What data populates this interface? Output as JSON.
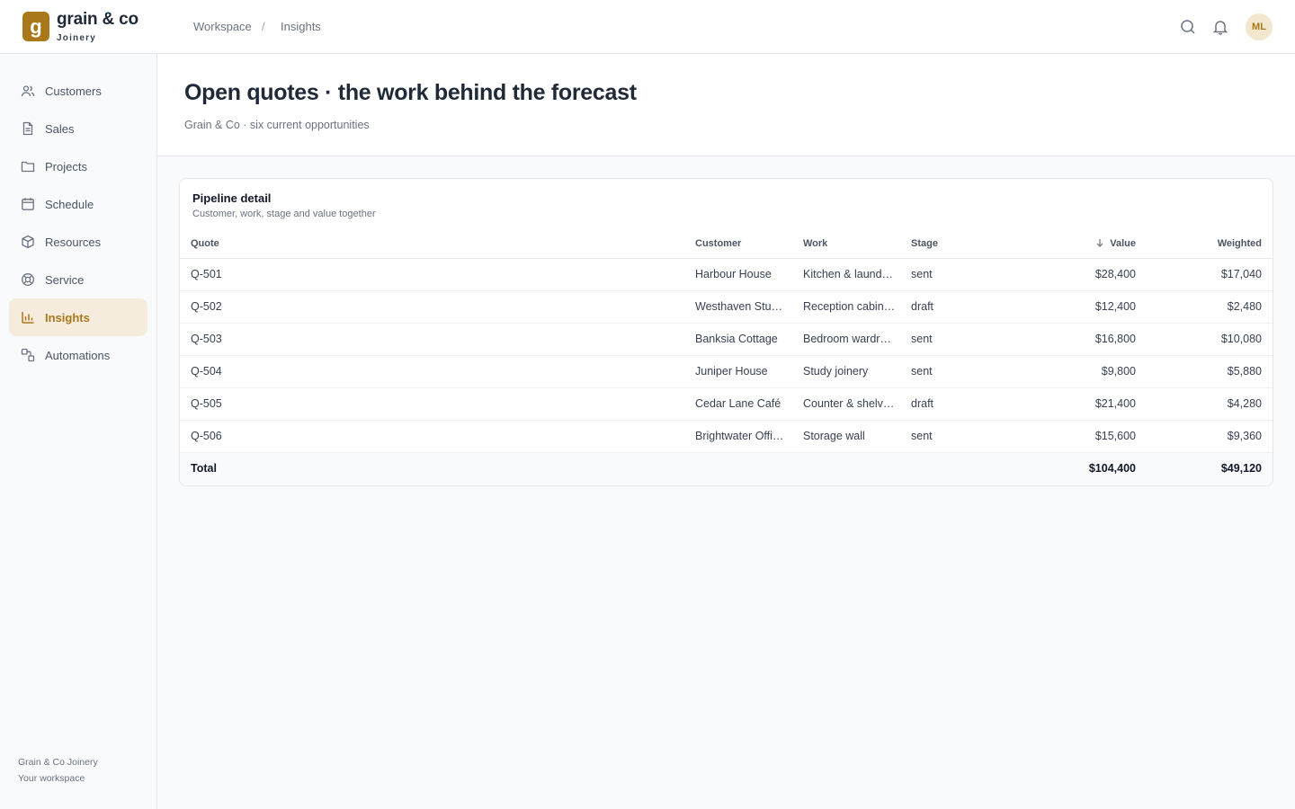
{
  "brand": {
    "logo_letter": "g",
    "name": "grain & co",
    "sub": "Joinery"
  },
  "breadcrumb": {
    "items": [
      "Workspace",
      "Insights"
    ],
    "separator": "/"
  },
  "header_icons": [
    "search-icon",
    "bell-icon"
  ],
  "user": {
    "initials": "ML"
  },
  "sidebar": {
    "items": [
      {
        "label": "Customers",
        "icon": "users-icon"
      },
      {
        "label": "Sales",
        "icon": "document-icon"
      },
      {
        "label": "Projects",
        "icon": "folder-icon"
      },
      {
        "label": "Schedule",
        "icon": "calendar-icon"
      },
      {
        "label": "Resources",
        "icon": "box-icon"
      },
      {
        "label": "Service",
        "icon": "lifebuoy-icon"
      },
      {
        "label": "Insights",
        "icon": "bar-chart-icon",
        "active": true
      },
      {
        "label": "Automations",
        "icon": "automation-icon"
      }
    ],
    "footer_line1": "Grain & Co Joinery",
    "footer_line2": "Your workspace"
  },
  "page": {
    "title": "Open quotes · the work behind the forecast",
    "subtitle": "Grain & Co · six current opportunities"
  },
  "card": {
    "title": "Pipeline detail",
    "subtitle": "Customer, work, stage and value together",
    "columns": {
      "quote": "Quote",
      "customer": "Customer",
      "work": "Work",
      "stage": "Stage",
      "value": "Value",
      "weighted": "Weighted"
    },
    "sort": {
      "column": "value",
      "direction": "descending"
    },
    "rows": [
      {
        "quote": "Q-501",
        "customer": "Harbour House",
        "work": "Kitchen & laund…",
        "stage": "sent",
        "value": "$28,400",
        "weighted": "$17,040"
      },
      {
        "quote": "Q-502",
        "customer": "Westhaven Stu…",
        "work": "Reception cabin…",
        "stage": "draft",
        "value": "$12,400",
        "weighted": "$2,480"
      },
      {
        "quote": "Q-503",
        "customer": "Banksia Cottage",
        "work": "Bedroom wardr…",
        "stage": "sent",
        "value": "$16,800",
        "weighted": "$10,080"
      },
      {
        "quote": "Q-504",
        "customer": "Juniper House",
        "work": "Study joinery",
        "stage": "sent",
        "value": "$9,800",
        "weighted": "$5,880"
      },
      {
        "quote": "Q-505",
        "customer": "Cedar Lane Café",
        "work": "Counter & shelv…",
        "stage": "draft",
        "value": "$21,400",
        "weighted": "$4,280"
      },
      {
        "quote": "Q-506",
        "customer": "Brightwater Offi…",
        "work": "Storage wall",
        "stage": "sent",
        "value": "$15,600",
        "weighted": "$9,360"
      }
    ],
    "total": {
      "label": "Total",
      "value": "$104,400",
      "weighted": "$49,120"
    }
  },
  "colors": {
    "accent": "#a8781a",
    "accent_bg": "#f5ecdd",
    "background": "#f8fafc",
    "border": "#e5e7eb"
  }
}
